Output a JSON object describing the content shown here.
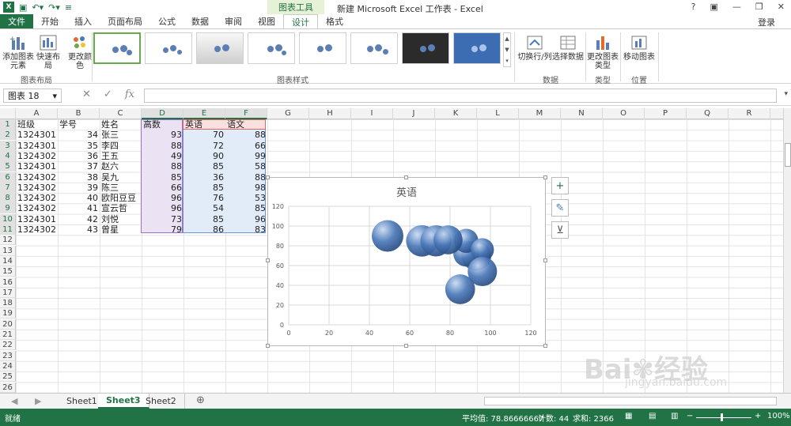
{
  "title": {
    "ctx_tab": "图表工具",
    "window_title": "新建 Microsoft Excel 工作表 - Excel",
    "help": "?",
    "login": "登录"
  },
  "tabs": [
    "文件",
    "开始",
    "插入",
    "页面布局",
    "公式",
    "数据",
    "审阅",
    "视图",
    "设计",
    "格式"
  ],
  "ribbon": {
    "add_element": "添加图表元素",
    "quick_layout": "快速布局",
    "change_colors": "更改颜色",
    "group_layout": "图表布局",
    "group_styles": "图表样式",
    "switch_row_col": "切换行/列",
    "select_data": "选择数据",
    "group_data": "数据",
    "change_type": "更改图表类型",
    "group_type": "类型",
    "move_chart": "移动图表",
    "group_position": "位置"
  },
  "formula_bar": {
    "name_box": "图表 18",
    "fx": "fx",
    "value": ""
  },
  "columns": [
    "A",
    "B",
    "C",
    "D",
    "E",
    "F",
    "G",
    "H",
    "I",
    "J",
    "K",
    "L",
    "M",
    "N",
    "O",
    "P",
    "Q",
    "R"
  ],
  "rows": [
    "1",
    "2",
    "3",
    "4",
    "5",
    "6",
    "7",
    "8",
    "9",
    "10",
    "11",
    "12",
    "13",
    "14",
    "15",
    "16",
    "17",
    "18",
    "19",
    "20",
    "21",
    "22",
    "23",
    "24",
    "25",
    "26"
  ],
  "table": {
    "headers": [
      "班级",
      "学号",
      "姓名",
      "高数",
      "英语",
      "语文"
    ],
    "data": [
      [
        "1324301",
        "34",
        "张三",
        "93",
        "70",
        "88"
      ],
      [
        "1324301",
        "35",
        "李四",
        "88",
        "72",
        "66"
      ],
      [
        "1324302",
        "36",
        "王五",
        "49",
        "90",
        "99"
      ],
      [
        "1324301",
        "37",
        "赵六",
        "88",
        "85",
        "58"
      ],
      [
        "1324302",
        "38",
        "吴九",
        "85",
        "36",
        "88"
      ],
      [
        "1324302",
        "39",
        "陈三",
        "66",
        "85",
        "98"
      ],
      [
        "1324302",
        "40",
        "欧阳豆豆",
        "96",
        "76",
        "53"
      ],
      [
        "1324302",
        "41",
        "宣云哲",
        "96",
        "54",
        "85"
      ],
      [
        "1324301",
        "42",
        "刘悦",
        "73",
        "85",
        "96"
      ],
      [
        "1324302",
        "43",
        "曾星",
        "79",
        "86",
        "83"
      ]
    ]
  },
  "chart_data": {
    "type": "scatter",
    "title": "英语",
    "xlabel": "",
    "ylabel": "",
    "xlim": [
      0,
      120
    ],
    "ylim": [
      0,
      120
    ],
    "xticks": [
      "0",
      "20",
      "40",
      "60",
      "80",
      "100",
      "120"
    ],
    "yticks": [
      "0",
      "20",
      "40",
      "60",
      "80",
      "100",
      "120"
    ],
    "series": [
      {
        "x": [
          93,
          88,
          49,
          88,
          85,
          66,
          96,
          96,
          73,
          79
        ],
        "y": [
          70,
          72,
          90,
          85,
          36,
          85,
          76,
          54,
          85,
          86
        ],
        "size": [
          88,
          66,
          99,
          58,
          88,
          98,
          53,
          85,
          96,
          83
        ]
      }
    ],
    "color": "#4a78b8"
  },
  "chart_buttons": {
    "add": "+",
    "style": "✎",
    "filter": "⊻"
  },
  "sheets": [
    "Sheet1",
    "Sheet3",
    "Sheet2"
  ],
  "status": {
    "ready": "就绪",
    "average": "平均值: 78.86666667",
    "count": "计数: 44",
    "sum": "求和: 2366",
    "zoom": "100%"
  },
  "watermark": {
    "brand": "Bai",
    "brand2": "经验",
    "url": "jingyan.baidu.com"
  }
}
